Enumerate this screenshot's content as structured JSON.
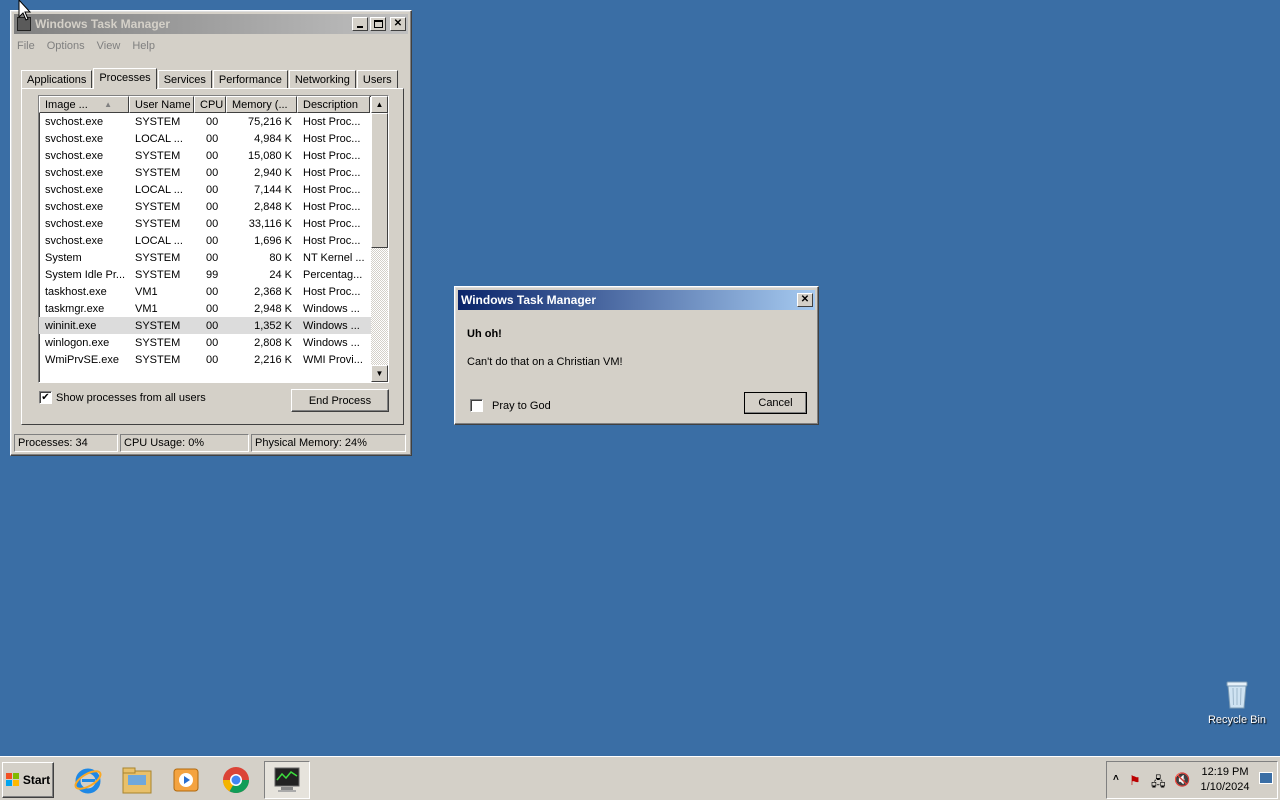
{
  "task_manager": {
    "title": "Windows Task Manager",
    "menu": [
      "File",
      "Options",
      "View",
      "Help"
    ],
    "tabs": [
      "Applications",
      "Processes",
      "Services",
      "Performance",
      "Networking",
      "Users"
    ],
    "selected_tab": "Processes",
    "columns": [
      "Image ...",
      "User Name",
      "CPU",
      "Memory (...",
      "Description"
    ],
    "rows": [
      {
        "image": "svchost.exe",
        "user": "SYSTEM",
        "cpu": "00",
        "memory": "75,216 K",
        "desc": "Host Proc..."
      },
      {
        "image": "svchost.exe",
        "user": "LOCAL ...",
        "cpu": "00",
        "memory": "4,984 K",
        "desc": "Host Proc..."
      },
      {
        "image": "svchost.exe",
        "user": "SYSTEM",
        "cpu": "00",
        "memory": "15,080 K",
        "desc": "Host Proc..."
      },
      {
        "image": "svchost.exe",
        "user": "SYSTEM",
        "cpu": "00",
        "memory": "2,940 K",
        "desc": "Host Proc..."
      },
      {
        "image": "svchost.exe",
        "user": "LOCAL ...",
        "cpu": "00",
        "memory": "7,144 K",
        "desc": "Host Proc..."
      },
      {
        "image": "svchost.exe",
        "user": "SYSTEM",
        "cpu": "00",
        "memory": "2,848 K",
        "desc": "Host Proc..."
      },
      {
        "image": "svchost.exe",
        "user": "SYSTEM",
        "cpu": "00",
        "memory": "33,116 K",
        "desc": "Host Proc..."
      },
      {
        "image": "svchost.exe",
        "user": "LOCAL ...",
        "cpu": "00",
        "memory": "1,696 K",
        "desc": "Host Proc..."
      },
      {
        "image": "System",
        "user": "SYSTEM",
        "cpu": "00",
        "memory": "80 K",
        "desc": "NT Kernel ..."
      },
      {
        "image": "System Idle Pr...",
        "user": "SYSTEM",
        "cpu": "99",
        "memory": "24 K",
        "desc": "Percentag..."
      },
      {
        "image": "taskhost.exe",
        "user": "VM1",
        "cpu": "00",
        "memory": "2,368 K",
        "desc": "Host Proc..."
      },
      {
        "image": "taskmgr.exe",
        "user": "VM1",
        "cpu": "00",
        "memory": "2,948 K",
        "desc": "Windows ..."
      },
      {
        "image": "wininit.exe",
        "user": "SYSTEM",
        "cpu": "00",
        "memory": "1,352 K",
        "desc": "Windows ...",
        "selected": true
      },
      {
        "image": "winlogon.exe",
        "user": "SYSTEM",
        "cpu": "00",
        "memory": "2,808 K",
        "desc": "Windows ..."
      },
      {
        "image": "WmiPrvSE.exe",
        "user": "SYSTEM",
        "cpu": "00",
        "memory": "2,216 K",
        "desc": "WMI Provi..."
      }
    ],
    "show_all_label": "Show processes from all users",
    "show_all_checked": true,
    "end_process_label": "End Process",
    "status": {
      "processes": "Processes: 34",
      "cpu": "CPU Usage: 0%",
      "memory": "Physical Memory: 24%"
    }
  },
  "dialog": {
    "title": "Windows Task Manager",
    "heading": "Uh oh!",
    "message": "Can't do that on a Christian VM!",
    "checkbox_label": "Pray to God",
    "checkbox_checked": false,
    "cancel_label": "Cancel"
  },
  "desktop": {
    "recycle_bin_label": "Recycle Bin"
  },
  "taskbar": {
    "start_label": "Start",
    "pinned": [
      "internet-explorer-icon",
      "windows-explorer-icon",
      "media-player-icon",
      "chrome-icon",
      "task-manager-icon"
    ],
    "clock_time": "12:19 PM",
    "clock_date": "1/10/2024"
  }
}
